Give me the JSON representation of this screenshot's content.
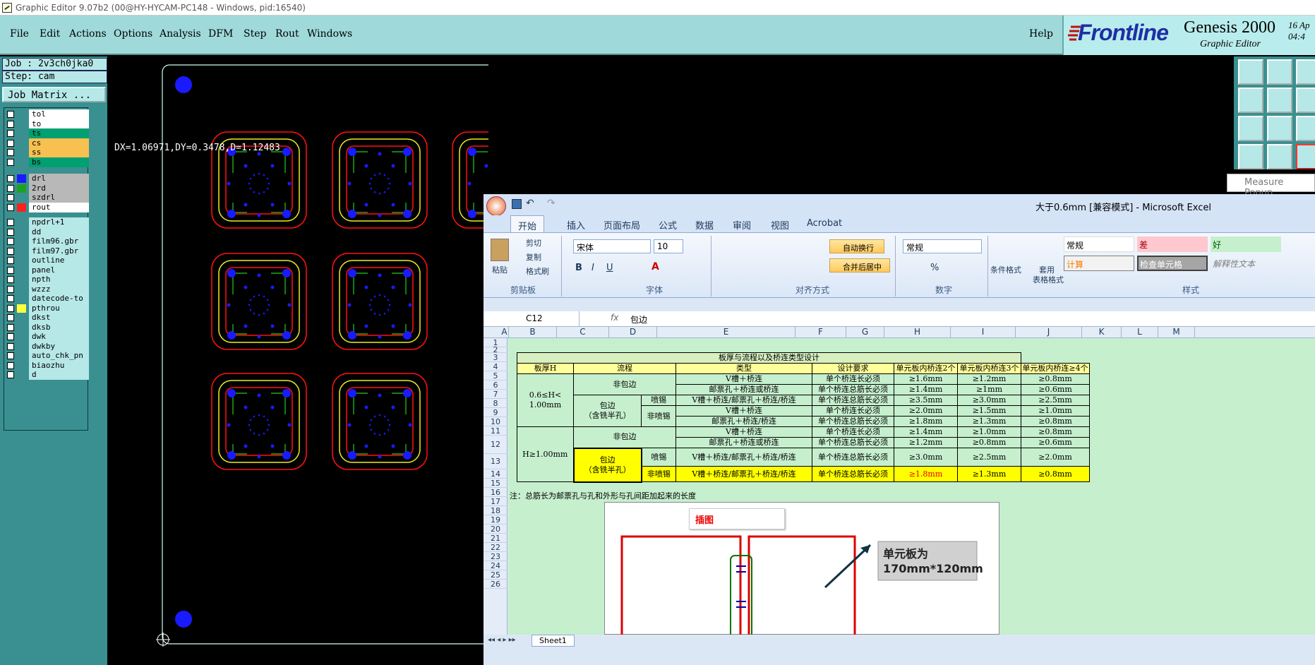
{
  "genesis": {
    "title": "Graphic Editor 9.07b2 (00@HY-HYCAM-PC148 - Windows, pid:16540)",
    "menu": [
      "File",
      "Edit",
      "Actions",
      "Options",
      "Analysis",
      "DFM",
      "Step",
      "Rout",
      "Windows"
    ],
    "help": "Help",
    "brand": {
      "logo": "Frontline",
      "product": "Genesis 2000",
      "sub": "Graphic Editor",
      "date1": "16  Ap",
      "date2": "04:4"
    },
    "job": "Job : 2v3ch0jka0",
    "step": "Step: cam",
    "job_matrix": "Job Matrix ...",
    "measure": "DX=1.06971,DY=0.3478,D=1.12483",
    "measure_popup": "Measure Popup",
    "layers": [
      {
        "name": "tol",
        "bg": "#ffffff",
        "sw": ""
      },
      {
        "name": "to",
        "bg": "#ffffff",
        "sw": ""
      },
      {
        "name": "ts",
        "bg": "#00a070",
        "sw": ""
      },
      {
        "name": "cs",
        "bg": "#f8c050",
        "sw": ""
      },
      {
        "name": "ss",
        "bg": "#f8c050",
        "sw": ""
      },
      {
        "name": "bs",
        "bg": "#00a070",
        "sw": ""
      },
      {
        "name": "drl",
        "bg": "#b8b8b8",
        "sw": "#1a1aff"
      },
      {
        "name": "2rd",
        "bg": "#b8b8b8",
        "sw": "#20a020"
      },
      {
        "name": "szdrl",
        "bg": "#b8b8b8",
        "sw": ""
      },
      {
        "name": "rout",
        "bg": "#ffffff",
        "sw": "#ff2020"
      },
      {
        "name": "npdrl+1",
        "bg": "#b6e8e8",
        "sw": ""
      },
      {
        "name": "dd",
        "bg": "#b6e8e8",
        "sw": ""
      },
      {
        "name": "film96.gbr",
        "bg": "#b6e8e8",
        "sw": ""
      },
      {
        "name": "film97.gbr",
        "bg": "#b6e8e8",
        "sw": ""
      },
      {
        "name": "outline",
        "bg": "#b6e8e8",
        "sw": ""
      },
      {
        "name": "panel",
        "bg": "#b6e8e8",
        "sw": ""
      },
      {
        "name": "npth",
        "bg": "#b6e8e8",
        "sw": ""
      },
      {
        "name": "wzzz",
        "bg": "#b6e8e8",
        "sw": ""
      },
      {
        "name": "datecode-to",
        "bg": "#b6e8e8",
        "sw": ""
      },
      {
        "name": "pthrou",
        "bg": "#b6e8e8",
        "sw": "#ffff40"
      },
      {
        "name": "dkst",
        "bg": "#b6e8e8",
        "sw": ""
      },
      {
        "name": "dksb",
        "bg": "#b6e8e8",
        "sw": ""
      },
      {
        "name": "dwk",
        "bg": "#b6e8e8",
        "sw": ""
      },
      {
        "name": "dwkby",
        "bg": "#b6e8e8",
        "sw": ""
      },
      {
        "name": "auto_chk_pn",
        "bg": "#b6e8e8",
        "sw": ""
      },
      {
        "name": "biaozhu",
        "bg": "#b6e8e8",
        "sw": ""
      },
      {
        "name": "d",
        "bg": "#b6e8e8",
        "sw": ""
      }
    ]
  },
  "excel": {
    "title": "大于0.6mm  [兼容模式] - Microsoft Excel",
    "tabs": [
      "开始",
      "插入",
      "页面布局",
      "公式",
      "数据",
      "审阅",
      "视图",
      "Acrobat"
    ],
    "clipboard": {
      "paste": "粘贴",
      "cut": "剪切",
      "copy": "复制",
      "painter": "格式刷",
      "label": "剪贴板"
    },
    "font": {
      "name": "宋体",
      "size": "10",
      "label": "字体"
    },
    "align": {
      "wrap": "自动换行",
      "merge": "合并后居中",
      "label": "对齐方式"
    },
    "number": {
      "format": "常规",
      "label": "数字"
    },
    "styles": {
      "cond": "条件格式",
      "table1": "套用",
      "table2": "表格格式",
      "s1": "常规",
      "s2": "差",
      "s3": "好",
      "s4": "计算",
      "s5": "检查单元格",
      "s6": "解释性文本",
      "label": "样式"
    },
    "namebox": "C12",
    "fx": "fx",
    "formula": "包边",
    "columns": [
      "A",
      "B",
      "C",
      "D",
      "E",
      "F",
      "G",
      "H",
      "I",
      "J",
      "K",
      "L",
      "M"
    ],
    "rows": [
      "1",
      "2",
      "3",
      "4",
      "5",
      "6",
      "7",
      "8",
      "9",
      "10",
      "11",
      "12",
      "13",
      "14",
      "15",
      "16",
      "17",
      "18",
      "19",
      "20",
      "21",
      "22",
      "23",
      "24",
      "25",
      "26"
    ],
    "table": {
      "title": "板厚与流程以及桥连类型设计",
      "headers": [
        "板厚H",
        "流程",
        "类型",
        "设计要求",
        "单元板内桥连2个",
        "单元板内桥连3个",
        "单元板内桥连≥4个"
      ],
      "thick1": "0.6≤H<\n1.00mm",
      "thick2": "H≥1.00mm",
      "nonwrap": "非包边",
      "wrap": "包边\n（含铣半孔）",
      "spray": "喷锡",
      "nospray": "非喷锡",
      "rows": [
        [
          "V槽＋桥连",
          "单个桥连长必须",
          "≥1.6mm",
          "≥1.2mm",
          "≥0.8mm"
        ],
        [
          "邮票孔＋桥连或桥连",
          "单个桥连总筋长必须",
          "≥1.4mm",
          "≥1mm",
          "≥0.6mm"
        ],
        [
          "V槽＋桥连/邮票孔＋桥连/桥连",
          "单个桥连总筋长必须",
          "≥3.5mm",
          "≥3.0mm",
          "≥2.5mm"
        ],
        [
          "V槽＋桥连",
          "单个桥连长必须",
          "≥2.0mm",
          "≥1.5mm",
          "≥1.0mm"
        ],
        [
          "邮票孔＋桥连/桥连",
          "单个桥连总筋长必须",
          "≥1.8mm",
          "≥1.3mm",
          "≥0.8mm"
        ],
        [
          "V槽＋桥连",
          "单个桥连长必须",
          "≥1.4mm",
          "≥1.0mm",
          "≥0.8mm"
        ],
        [
          "邮票孔＋桥连或桥连",
          "单个桥连总筋长必须",
          "≥1.2mm",
          "≥0.8mm",
          "≥0.6mm"
        ],
        [
          "V槽＋桥连/邮票孔＋桥连/桥连",
          "单个桥连总筋长必须",
          "≥3.0mm",
          "≥2.5mm",
          "≥2.0mm"
        ],
        [
          "V槽＋桥连/邮票孔＋桥连/桥连",
          "单个桥连总筋长必须",
          "≥1.8mm",
          "≥1.3mm",
          "≥0.8mm"
        ]
      ],
      "note": "注：总筋长为邮票孔与孔和外形与孔间距加起来的长度"
    },
    "picture_label": "插图",
    "callout": "单元板为\n170mm*120mm",
    "sheet_tab": "Sheet1"
  }
}
